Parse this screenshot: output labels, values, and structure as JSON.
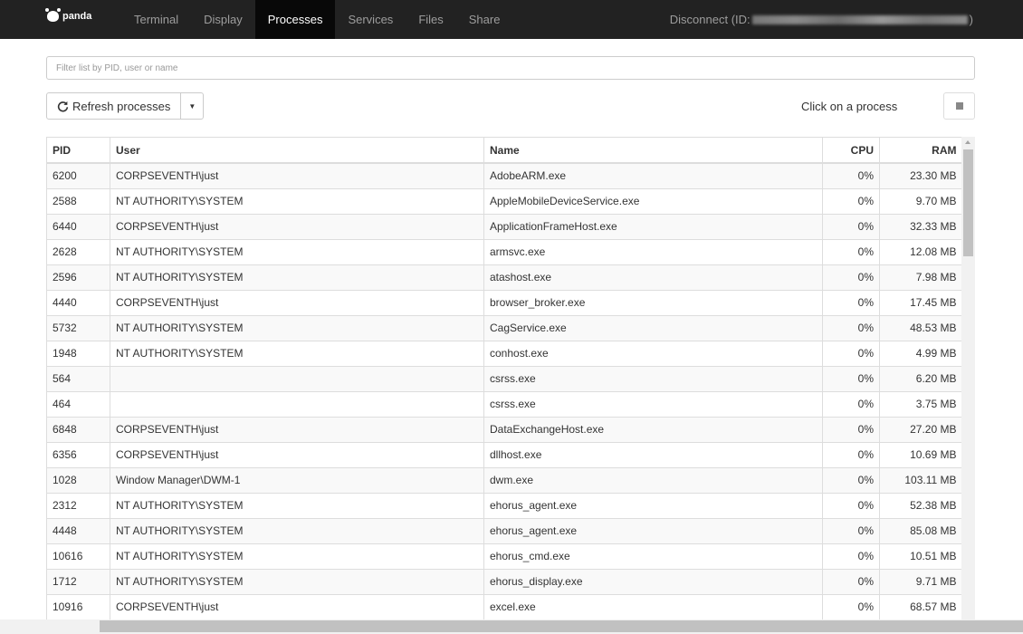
{
  "nav": {
    "logo": "panda",
    "tabs": [
      "Terminal",
      "Display",
      "Processes",
      "Services",
      "Files",
      "Share"
    ],
    "active_tab": "Processes",
    "disconnect_prefix": "Disconnect (ID:",
    "disconnect_suffix": ")"
  },
  "filter": {
    "placeholder": "Filter list by PID, user or name",
    "value": ""
  },
  "toolbar": {
    "refresh_label": "Refresh processes",
    "refresh_icon": "refresh-icon",
    "hint": "Click on a process",
    "stop_icon": "stop-icon"
  },
  "table": {
    "columns": [
      "PID",
      "User",
      "Name",
      "CPU",
      "RAM"
    ],
    "rows": [
      [
        "6200",
        "CORPSEVENTH\\just",
        "AdobeARM.exe",
        "0%",
        "23.30 MB"
      ],
      [
        "2588",
        "NT AUTHORITY\\SYSTEM",
        "AppleMobileDeviceService.exe",
        "0%",
        "9.70 MB"
      ],
      [
        "6440",
        "CORPSEVENTH\\just",
        "ApplicationFrameHost.exe",
        "0%",
        "32.33 MB"
      ],
      [
        "2628",
        "NT AUTHORITY\\SYSTEM",
        "armsvc.exe",
        "0%",
        "12.08 MB"
      ],
      [
        "2596",
        "NT AUTHORITY\\SYSTEM",
        "atashost.exe",
        "0%",
        "7.98 MB"
      ],
      [
        "4440",
        "CORPSEVENTH\\just",
        "browser_broker.exe",
        "0%",
        "17.45 MB"
      ],
      [
        "5732",
        "NT AUTHORITY\\SYSTEM",
        "CagService.exe",
        "0%",
        "48.53 MB"
      ],
      [
        "1948",
        "NT AUTHORITY\\SYSTEM",
        "conhost.exe",
        "0%",
        "4.99 MB"
      ],
      [
        "564",
        "",
        "csrss.exe",
        "0%",
        "6.20 MB"
      ],
      [
        "464",
        "",
        "csrss.exe",
        "0%",
        "3.75 MB"
      ],
      [
        "6848",
        "CORPSEVENTH\\just",
        "DataExchangeHost.exe",
        "0%",
        "27.20 MB"
      ],
      [
        "6356",
        "CORPSEVENTH\\just",
        "dllhost.exe",
        "0%",
        "10.69 MB"
      ],
      [
        "1028",
        "Window Manager\\DWM-1",
        "dwm.exe",
        "0%",
        "103.11 MB"
      ],
      [
        "2312",
        "NT AUTHORITY\\SYSTEM",
        "ehorus_agent.exe",
        "0%",
        "52.38 MB"
      ],
      [
        "4448",
        "NT AUTHORITY\\SYSTEM",
        "ehorus_agent.exe",
        "0%",
        "85.08 MB"
      ],
      [
        "10616",
        "NT AUTHORITY\\SYSTEM",
        "ehorus_cmd.exe",
        "0%",
        "10.51 MB"
      ],
      [
        "1712",
        "NT AUTHORITY\\SYSTEM",
        "ehorus_display.exe",
        "0%",
        "9.71 MB"
      ],
      [
        "10916",
        "CORPSEVENTH\\just",
        "excel.exe",
        "0%",
        "68.57 MB"
      ],
      [
        "",
        "",
        "",
        "",
        ""
      ]
    ]
  }
}
